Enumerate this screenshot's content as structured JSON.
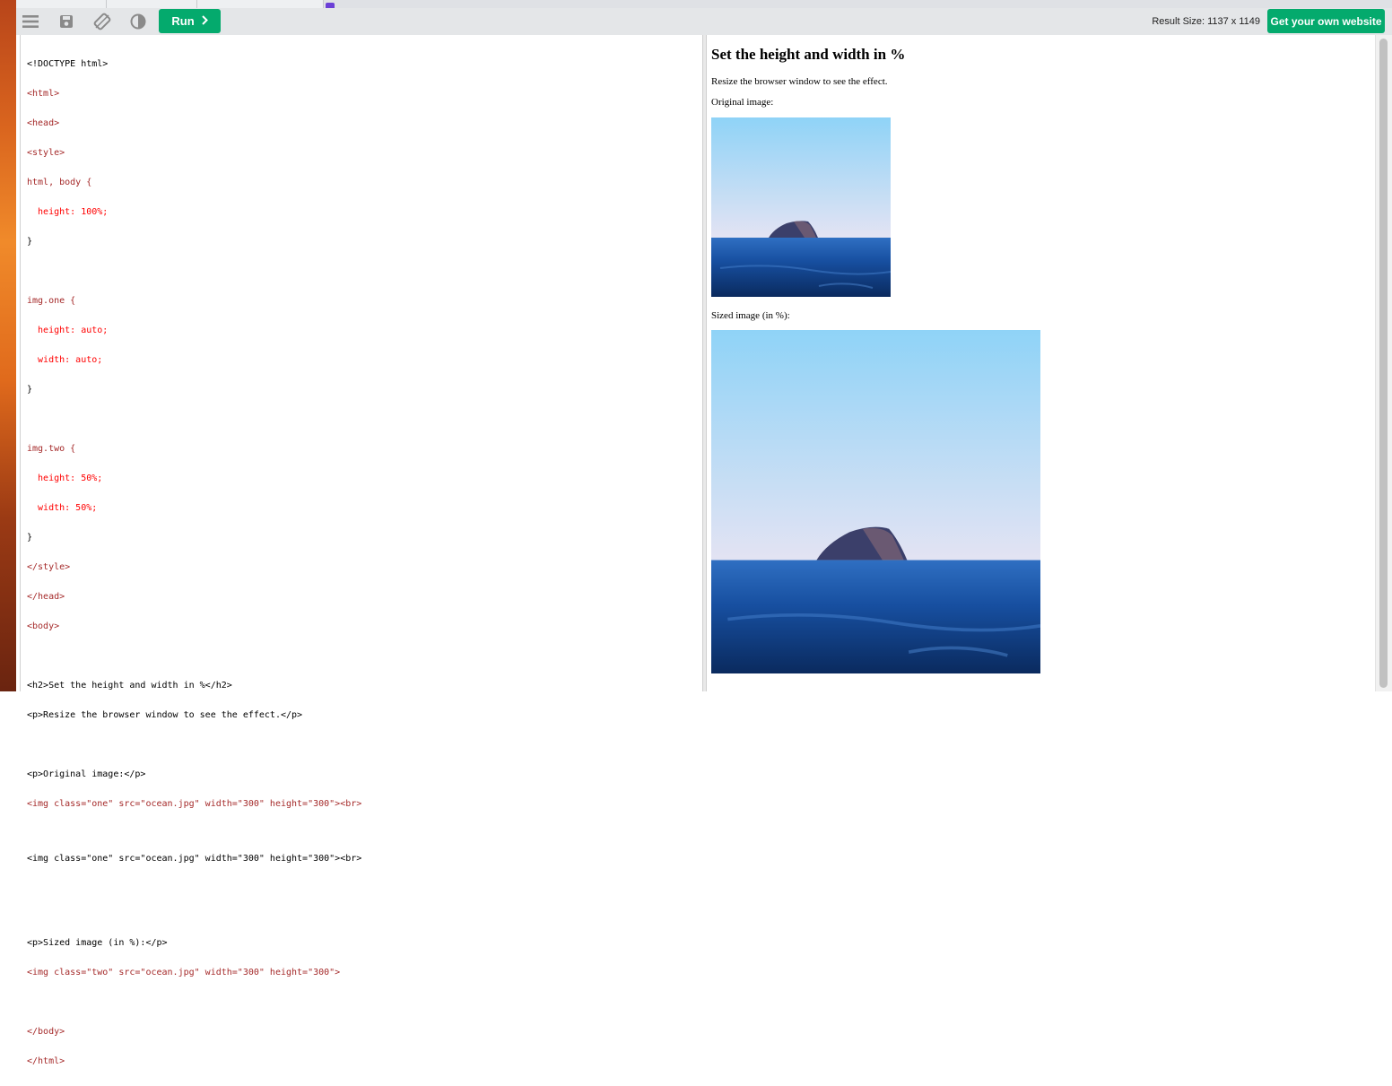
{
  "toolbar": {
    "run_label": "Run",
    "result_size": "Result Size: 1137 x 1149",
    "own_site_label": "Get your own website",
    "icons": [
      "menu-icon",
      "save-icon",
      "rotate-icon",
      "contrast-icon",
      "chevron-right-icon"
    ]
  },
  "colors": {
    "accent_green": "#04aa6d",
    "toolbar_bg": "#e4e6e8",
    "tag_color": "#a52a2a",
    "attr_color": "#ff0000",
    "value_color": "#0000cd"
  },
  "editor": {
    "lines": [
      "<!DOCTYPE html>",
      "<html>",
      "<head>",
      "<style>",
      "html, body {",
      "  height: 100%;",
      "}",
      "",
      "img.one {",
      "  height: auto;",
      "  width: auto;",
      "}",
      "",
      "img.two {",
      "  height: 50%;",
      "  width: 50%;",
      "}",
      "</style>",
      "</head>",
      "<body>",
      "",
      "<h2>Set the height and width in %</h2>",
      "<p>Resize the browser window to see the effect.</p>",
      "",
      "<p>Original image:</p>",
      "<img class=\"one\" src=\"ocean.jpg\" width=\"300\" height=\"300\"><br>",
      "<img class=\"one\" src=\"ocean.jpg\" width=\"300\" height=\"300\"><br>",
      "",
      "<p>Sized image (in %):</p>",
      "<img class=\"two\" src=\"ocean.jpg\" width=\"300\" height=\"300\">",
      "",
      "</body>",
      "</html>"
    ]
  },
  "result": {
    "heading": "Set the height and width in %",
    "paragraph": "Resize the browser window to see the effect.",
    "original_label": "Original image:",
    "sized_label": "Sized image (in %):"
  }
}
